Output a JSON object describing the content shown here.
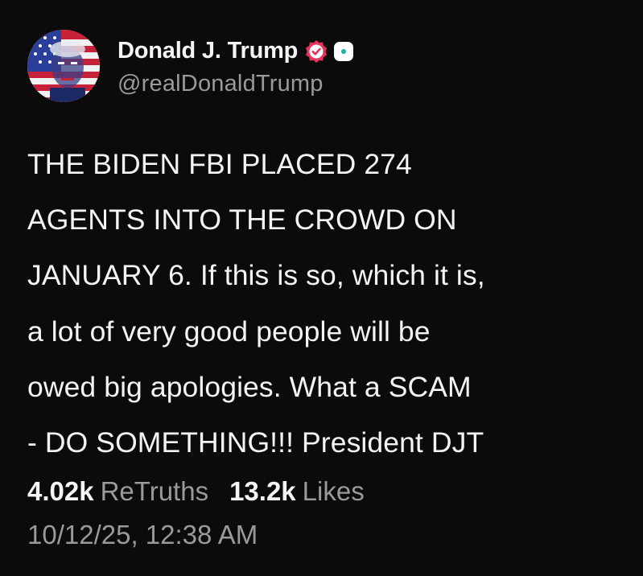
{
  "author": {
    "display_name": "Donald J. Trump",
    "handle": "@realDonaldTrump",
    "avatar_icon": "profile-avatar-flag-portrait",
    "verified_icon": "verified-badge-icon",
    "affiliation_icon": "affiliation-badge-icon"
  },
  "post": {
    "lines": [
      "THE BIDEN FBI PLACED 274",
      "AGENTS INTO THE CROWD ON",
      "JANUARY 6. If this is so, which it is,",
      "a lot of very good people will be",
      "owed big apologies. What a SCAM",
      "- DO SOMETHING!!! President DJT"
    ]
  },
  "stats": {
    "retruths_count": "4.02k",
    "retruths_label": "ReTruths",
    "likes_count": "13.2k",
    "likes_label": "Likes"
  },
  "timestamp": "10/12/25, 12:38 AM",
  "colors": {
    "background": "#0b0b0b",
    "text_primary": "#f4f4f4",
    "text_secondary": "#9a9a9a",
    "verified": "#e3345c"
  }
}
